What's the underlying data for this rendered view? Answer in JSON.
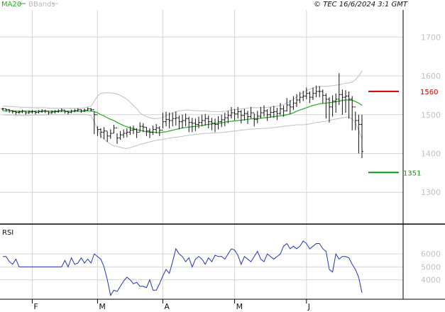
{
  "header": {
    "ma_label": "MA20",
    "bb_label": "BBands",
    "copyright": "© TEC 16/6/2024 3:1 GMT"
  },
  "rsi_panel": {
    "title": "RSI"
  },
  "colors": {
    "ma": "#22aa22",
    "bbands": "#c0c0c0",
    "price": "#111111",
    "rsi": "#2233bb",
    "resistance": "#cc0000",
    "support": "#119911",
    "grid": "#d4d4d4",
    "frame": "#000000"
  },
  "levels": {
    "resistance": {
      "value": 1560,
      "label": "1560"
    },
    "support": {
      "value": 1351,
      "label": "1351"
    }
  },
  "chart_data": [
    {
      "type": "ohlc",
      "ylim": [
        1220,
        1770
      ],
      "y_ticks": [
        1300,
        1400,
        1500,
        1600,
        1700
      ],
      "y_tick_labels": [
        "1300",
        "1400",
        "1500",
        "1600",
        "1700"
      ],
      "x_labels": [
        "F",
        "M",
        "A",
        "M",
        "J"
      ],
      "x_label_positions": [
        9,
        29,
        49,
        71,
        93
      ],
      "grid": true,
      "close": [
        1515,
        1513,
        1510,
        1508,
        1506,
        1507,
        1509,
        1505,
        1507,
        1508,
        1506,
        1508,
        1510,
        1509,
        1505,
        1507,
        1508,
        1510,
        1512,
        1508,
        1506,
        1509,
        1511,
        1513,
        1510,
        1512,
        1515,
        1513,
        1500,
        1462,
        1455,
        1458,
        1445,
        1452,
        1466,
        1440,
        1448,
        1452,
        1455,
        1460,
        1462,
        1455,
        1470,
        1468,
        1458,
        1455,
        1462,
        1466,
        1460,
        1482,
        1488,
        1485,
        1490,
        1492,
        1482,
        1485,
        1490,
        1480,
        1478,
        1475,
        1480,
        1485,
        1490,
        1482,
        1478,
        1475,
        1482,
        1487,
        1492,
        1498,
        1505,
        1502,
        1508,
        1498,
        1503,
        1495,
        1505,
        1488,
        1496,
        1505,
        1510,
        1500,
        1506,
        1508,
        1503,
        1515,
        1510,
        1525,
        1520,
        1530,
        1538,
        1545,
        1548,
        1555,
        1545,
        1555,
        1560,
        1560,
        1550,
        1540,
        1520,
        1535,
        1540,
        1552,
        1545,
        1548,
        1540,
        1520,
        1485,
        1475,
        1405
      ],
      "high": [
        1518,
        1516,
        1514,
        1512,
        1510,
        1511,
        1513,
        1509,
        1511,
        1512,
        1510,
        1512,
        1514,
        1513,
        1509,
        1511,
        1512,
        1514,
        1516,
        1512,
        1510,
        1513,
        1515,
        1517,
        1514,
        1516,
        1519,
        1517,
        1508,
        1470,
        1465,
        1468,
        1457,
        1462,
        1474,
        1452,
        1458,
        1462,
        1465,
        1470,
        1472,
        1465,
        1480,
        1478,
        1468,
        1465,
        1472,
        1476,
        1470,
        1505,
        1508,
        1505,
        1505,
        1508,
        1498,
        1500,
        1503,
        1495,
        1492,
        1490,
        1495,
        1500,
        1502,
        1498,
        1492,
        1490,
        1496,
        1500,
        1505,
        1510,
        1520,
        1515,
        1520,
        1512,
        1515,
        1510,
        1520,
        1503,
        1510,
        1520,
        1524,
        1514,
        1520,
        1523,
        1518,
        1530,
        1524,
        1543,
        1538,
        1548,
        1553,
        1558,
        1562,
        1570,
        1560,
        1570,
        1575,
        1574,
        1565,
        1555,
        1545,
        1550,
        1555,
        1607,
        1565,
        1563,
        1560,
        1548,
        1508,
        1500,
        1500
      ],
      "low": [
        1510,
        1508,
        1505,
        1503,
        1500,
        1502,
        1504,
        1500,
        1502,
        1503,
        1501,
        1503,
        1505,
        1504,
        1500,
        1502,
        1503,
        1505,
        1507,
        1503,
        1501,
        1504,
        1506,
        1508,
        1505,
        1507,
        1510,
        1508,
        1450,
        1445,
        1440,
        1437,
        1430,
        1438,
        1452,
        1425,
        1435,
        1440,
        1442,
        1448,
        1450,
        1440,
        1456,
        1455,
        1445,
        1440,
        1448,
        1452,
        1445,
        1465,
        1470,
        1465,
        1470,
        1472,
        1462,
        1465,
        1470,
        1455,
        1455,
        1458,
        1465,
        1470,
        1472,
        1465,
        1460,
        1455,
        1462,
        1468,
        1470,
        1478,
        1490,
        1486,
        1490,
        1478,
        1485,
        1476,
        1490,
        1470,
        1478,
        1490,
        1495,
        1484,
        1492,
        1492,
        1486,
        1500,
        1495,
        1508,
        1502,
        1512,
        1520,
        1530,
        1535,
        1540,
        1530,
        1538,
        1545,
        1545,
        1530,
        1490,
        1480,
        1495,
        1505,
        1525,
        1500,
        1505,
        1490,
        1460,
        1460,
        1400,
        1388
      ],
      "ma20": [
        1510,
        1510,
        1510,
        1510,
        1509,
        1509,
        1509,
        1509,
        1509,
        1509,
        1509,
        1509,
        1509,
        1509,
        1509,
        1509,
        1509,
        1509,
        1509,
        1509,
        1509,
        1509,
        1509,
        1509,
        1509,
        1509,
        1510,
        1510,
        1508,
        1505,
        1500,
        1497,
        1492,
        1488,
        1485,
        1480,
        1476,
        1472,
        1469,
        1466,
        1464,
        1461,
        1460,
        1458,
        1456,
        1455,
        1455,
        1454,
        1454,
        1455,
        1456,
        1458,
        1460,
        1462,
        1464,
        1466,
        1467,
        1468,
        1469,
        1470,
        1471,
        1472,
        1474,
        1475,
        1476,
        1477,
        1478,
        1479,
        1481,
        1482,
        1483,
        1484,
        1485,
        1486,
        1487,
        1488,
        1489,
        1490,
        1490,
        1491,
        1492,
        1493,
        1494,
        1495,
        1496,
        1497,
        1498,
        1500,
        1502,
        1505,
        1509,
        1512,
        1515,
        1518,
        1521,
        1524,
        1526,
        1528,
        1529,
        1530,
        1531,
        1532,
        1533,
        1535,
        1537,
        1538,
        1538,
        1537,
        1534,
        1530,
        1524
      ],
      "bb_upper": [
        1522,
        1522,
        1521,
        1521,
        1520,
        1520,
        1519,
        1519,
        1519,
        1518,
        1518,
        1518,
        1518,
        1518,
        1517,
        1517,
        1517,
        1517,
        1517,
        1517,
        1517,
        1517,
        1517,
        1517,
        1517,
        1518,
        1520,
        1522,
        1535,
        1548,
        1555,
        1556,
        1557,
        1556,
        1555,
        1553,
        1550,
        1545,
        1540,
        1532,
        1524,
        1516,
        1505,
        1499,
        1495,
        1492,
        1490,
        1490,
        1491,
        1493,
        1497,
        1502,
        1505,
        1508,
        1510,
        1511,
        1512,
        1512,
        1511,
        1510,
        1510,
        1510,
        1510,
        1509,
        1508,
        1508,
        1508,
        1508,
        1509,
        1510,
        1512,
        1513,
        1514,
        1515,
        1516,
        1517,
        1518,
        1518,
        1518,
        1518,
        1519,
        1519,
        1520,
        1521,
        1522,
        1524,
        1526,
        1530,
        1534,
        1540,
        1546,
        1552,
        1557,
        1562,
        1566,
        1569,
        1571,
        1573,
        1573,
        1573,
        1574,
        1575,
        1576,
        1577,
        1579,
        1581,
        1582,
        1584,
        1590,
        1600,
        1612
      ],
      "bb_lower": [
        1500,
        1499,
        1499,
        1499,
        1498,
        1498,
        1498,
        1498,
        1498,
        1499,
        1499,
        1499,
        1499,
        1499,
        1500,
        1500,
        1500,
        1500,
        1500,
        1500,
        1501,
        1501,
        1501,
        1501,
        1501,
        1501,
        1500,
        1498,
        1482,
        1463,
        1446,
        1437,
        1430,
        1424,
        1420,
        1418,
        1416,
        1414,
        1413,
        1415,
        1418,
        1420,
        1424,
        1425,
        1428,
        1430,
        1432,
        1434,
        1435,
        1436,
        1438,
        1440,
        1441,
        1442,
        1443,
        1444,
        1446,
        1447,
        1448,
        1449,
        1450,
        1451,
        1452,
        1452,
        1453,
        1453,
        1454,
        1454,
        1455,
        1456,
        1457,
        1458,
        1459,
        1460,
        1461,
        1462,
        1463,
        1463,
        1464,
        1464,
        1465,
        1465,
        1466,
        1467,
        1468,
        1469,
        1470,
        1471,
        1472,
        1473,
        1474,
        1474,
        1474,
        1475,
        1476,
        1478,
        1480,
        1481,
        1482,
        1483,
        1485,
        1487,
        1489,
        1490,
        1492,
        1493,
        1494,
        1489,
        1479,
        1460,
        1437
      ]
    },
    {
      "type": "line",
      "name": "RSI",
      "ylim": [
        25,
        82
      ],
      "y_ticks": [
        40,
        50,
        60
      ],
      "y_tick_labels": [
        "4000",
        "5000",
        "6000"
      ],
      "values": [
        58,
        58,
        54,
        52,
        56,
        50,
        50,
        50,
        50,
        50,
        50,
        50,
        50,
        50,
        50,
        50,
        50,
        50,
        50,
        55,
        50,
        57,
        52,
        53,
        57,
        53,
        56,
        53,
        60,
        58,
        56,
        50,
        40,
        28,
        32,
        31,
        35,
        39,
        42,
        40,
        37,
        38,
        35,
        35,
        34,
        40,
        32,
        32,
        37,
        43,
        48,
        45,
        54,
        64,
        60,
        58,
        54,
        57,
        50,
        56,
        58,
        56,
        52,
        57,
        54,
        59,
        58,
        58,
        56,
        60,
        64,
        63,
        59,
        52,
        58,
        56,
        54,
        58,
        62,
        56,
        54,
        60,
        58,
        56,
        58,
        60,
        66,
        68,
        64,
        66,
        64,
        66,
        70,
        68,
        64,
        66,
        68,
        68,
        64,
        62,
        48,
        46,
        60,
        56,
        58,
        58,
        57,
        52,
        48,
        42,
        30
      ]
    }
  ]
}
